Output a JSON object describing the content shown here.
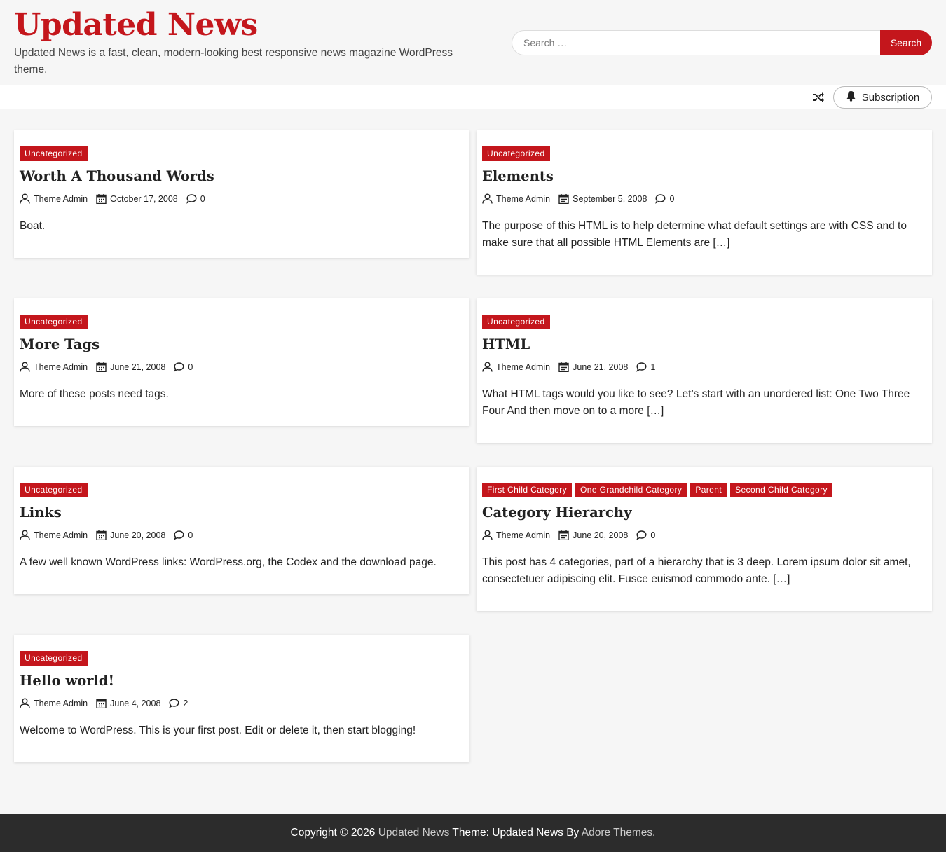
{
  "site": {
    "title": "Updated News",
    "description": "Updated News is a fast, clean, modern-looking best responsive news magazine WordPress theme."
  },
  "search": {
    "placeholder": "Search …",
    "button_label": "Search"
  },
  "nav": {
    "subscription_label": "Subscription"
  },
  "colors": {
    "accent": "#c4161c",
    "footer_bg": "#2c2c2c",
    "page_bg": "#f6f6f6"
  },
  "posts": [
    {
      "categories": [
        "Uncategorized"
      ],
      "title": "Worth A Thousand Words",
      "author": "Theme Admin",
      "date": "October 17, 2008",
      "comments": "0",
      "excerpt": "Boat."
    },
    {
      "categories": [
        "Uncategorized"
      ],
      "title": "Elements",
      "author": "Theme Admin",
      "date": "September 5, 2008",
      "comments": "0",
      "excerpt": "The purpose of this HTML is to help determine what default settings are with CSS and to make sure that all possible HTML Elements are […]"
    },
    {
      "categories": [
        "Uncategorized"
      ],
      "title": "More Tags",
      "author": "Theme Admin",
      "date": "June 21, 2008",
      "comments": "0",
      "excerpt": "More of these posts need tags."
    },
    {
      "categories": [
        "Uncategorized"
      ],
      "title": "HTML",
      "author": "Theme Admin",
      "date": "June 21, 2008",
      "comments": "1",
      "excerpt": "What HTML tags would you like to see? Let’s start with an unordered list: One Two Three Four And then move on to a more […]"
    },
    {
      "categories": [
        "Uncategorized"
      ],
      "title": "Links",
      "author": "Theme Admin",
      "date": "June 20, 2008",
      "comments": "0",
      "excerpt": "A few well known WordPress links: WordPress.org, the Codex and the download page."
    },
    {
      "categories": [
        "First Child Category",
        "One Grandchild Category",
        "Parent",
        "Second Child Category"
      ],
      "title": "Category Hierarchy",
      "author": "Theme Admin",
      "date": "June 20, 2008",
      "comments": "0",
      "excerpt": "This post has 4 categories, part of a hierarchy that is 3 deep. Lorem ipsum dolor sit amet, consectetuer adipiscing elit. Fusce euismod commodo ante. […]"
    },
    {
      "categories": [
        "Uncategorized"
      ],
      "title": "Hello world!",
      "author": "Theme Admin",
      "date": "June 4, 2008",
      "comments": "2",
      "excerpt": "Welcome to WordPress. This is your first post. Edit or delete it, then start blogging!"
    }
  ],
  "footer": {
    "copyright_prefix": "Copyright © 2026",
    "site_link": "Updated News",
    "theme_text": "Theme: Updated News By",
    "author_link": "Adore Themes",
    "suffix": "."
  }
}
